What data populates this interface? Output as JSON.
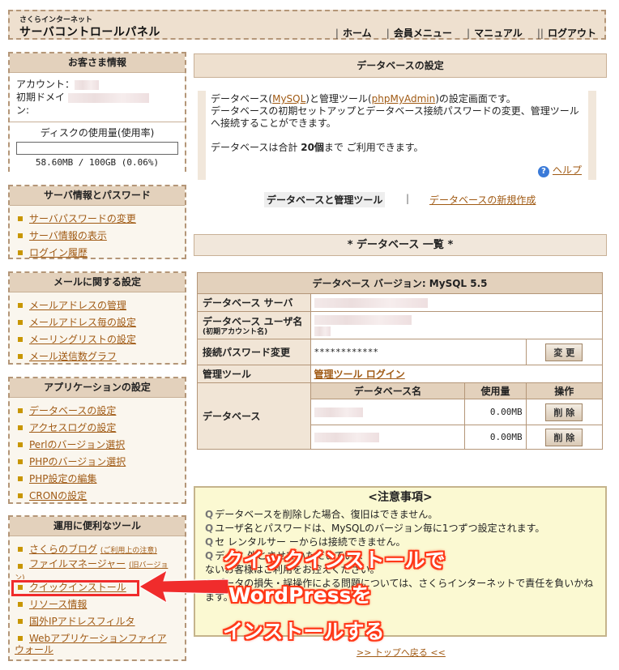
{
  "header": {
    "brand_small": "さくらインターネット",
    "brand_big": "サーバコントロールパネル",
    "nav": [
      "ホーム",
      "会員メニュー",
      "マニュアル",
      "ログアウト"
    ]
  },
  "customer": {
    "title": "お客さま情報",
    "account_label": "アカウント：",
    "domain_label_1": "初期ドメイ",
    "domain_label_2": "ン:",
    "disk_title": "ディスクの使用量(使用率)",
    "disk_usage": "58.60MB / 100GB (0.06%)",
    "disk_fraction": 0.0006
  },
  "server_info": {
    "title": "サーバ情報とパスワード",
    "items": [
      "サーバパスワードの変更",
      "サーバ情報の表示",
      "ログイン履歴"
    ]
  },
  "mail": {
    "title": "メールに関する設定",
    "items": [
      "メールアドレスの管理",
      "メールアドレス毎の設定",
      "メーリングリストの設定",
      "メール送信数グラフ"
    ]
  },
  "apps": {
    "title": "アプリケーションの設定",
    "items": [
      "データベースの設定",
      "アクセスログの設定",
      "Perlのバージョン選択",
      "PHPのバージョン選択",
      "PHP設定の編集",
      "CRONの設定"
    ]
  },
  "tools": {
    "title": "運用に便利なツール",
    "blog": "さくらのブログ",
    "blog_note": "(ご利用上の注意)",
    "filemanager": "ファイルマネージャー",
    "filemanager_note": "(旧バージョ",
    "filemanager_note2": "ン)",
    "quick_install": "クイックインストール",
    "resource": "リソース情報",
    "ip_filter": "国外IPアドレスフィルタ",
    "waf_1": "Webアプリケーションファイア",
    "waf_2": "ウォール"
  },
  "main": {
    "title": "データベースの設定",
    "intro_1": "データベース(",
    "intro_mysql": "MySQL",
    "intro_2": ")と管理ツール(",
    "intro_pma": "phpMyAdmin",
    "intro_3": ")の設定画面です。",
    "intro_4": "データベースの初期セットアップとデータベース接続パスワードの変更、管理ツール",
    "intro_5": "へ接続することができます。",
    "intro_6a": "データベースは合計 ",
    "intro_6b": "20個",
    "intro_6c": "まで ご利用できます。",
    "help": "ヘルプ",
    "tab_active": "データベースと管理ツール",
    "tab_sep": "|",
    "tab_new": "データベースの新規作成",
    "list_title": "* データベース 一覧 *"
  },
  "db_table": {
    "caption": "データベース バージョン: MySQL 5.5",
    "server_label": "データベース サーバ",
    "user_label": "データベース ユーザ名",
    "user_note": "(初期アカウント名)",
    "password_label": "接続パスワード変更",
    "password_value": "************",
    "change_button": "変 更",
    "tool_label": "管理ツール",
    "tool_link": "管理ツール ログイン",
    "db_label": "データベース",
    "col_name": "データベース名",
    "col_usage": "使用量",
    "col_op": "操作",
    "rows": [
      {
        "usage": "0.00MB",
        "button": "削 除"
      },
      {
        "usage": "0.00MB",
        "button": "削 除"
      }
    ]
  },
  "notice": {
    "title": "<注意事項>",
    "items": [
      "データベースを削除した場合、復旧はできません。",
      "ユーザ名とパスワードは、MySQLのバージョン毎に1つずつ設定されます。",
      "セ                              レンタルサー        ーからは接続できません。",
      "データ                                               外とさせていただいていま",
      "                    ないお客様はご利用をお控えください。",
      "データの損失・誤操作による問題については、さくらインターネットで責任を負いかね",
      "ます。"
    ],
    "bold_text": "ネット外"
  },
  "back_to_top": ">> トップへ戻る <<",
  "annotation": {
    "line1": "クイックインストールで",
    "line2": "WordPressを",
    "line3": "インストールする",
    "color": "#ff3a1a"
  }
}
